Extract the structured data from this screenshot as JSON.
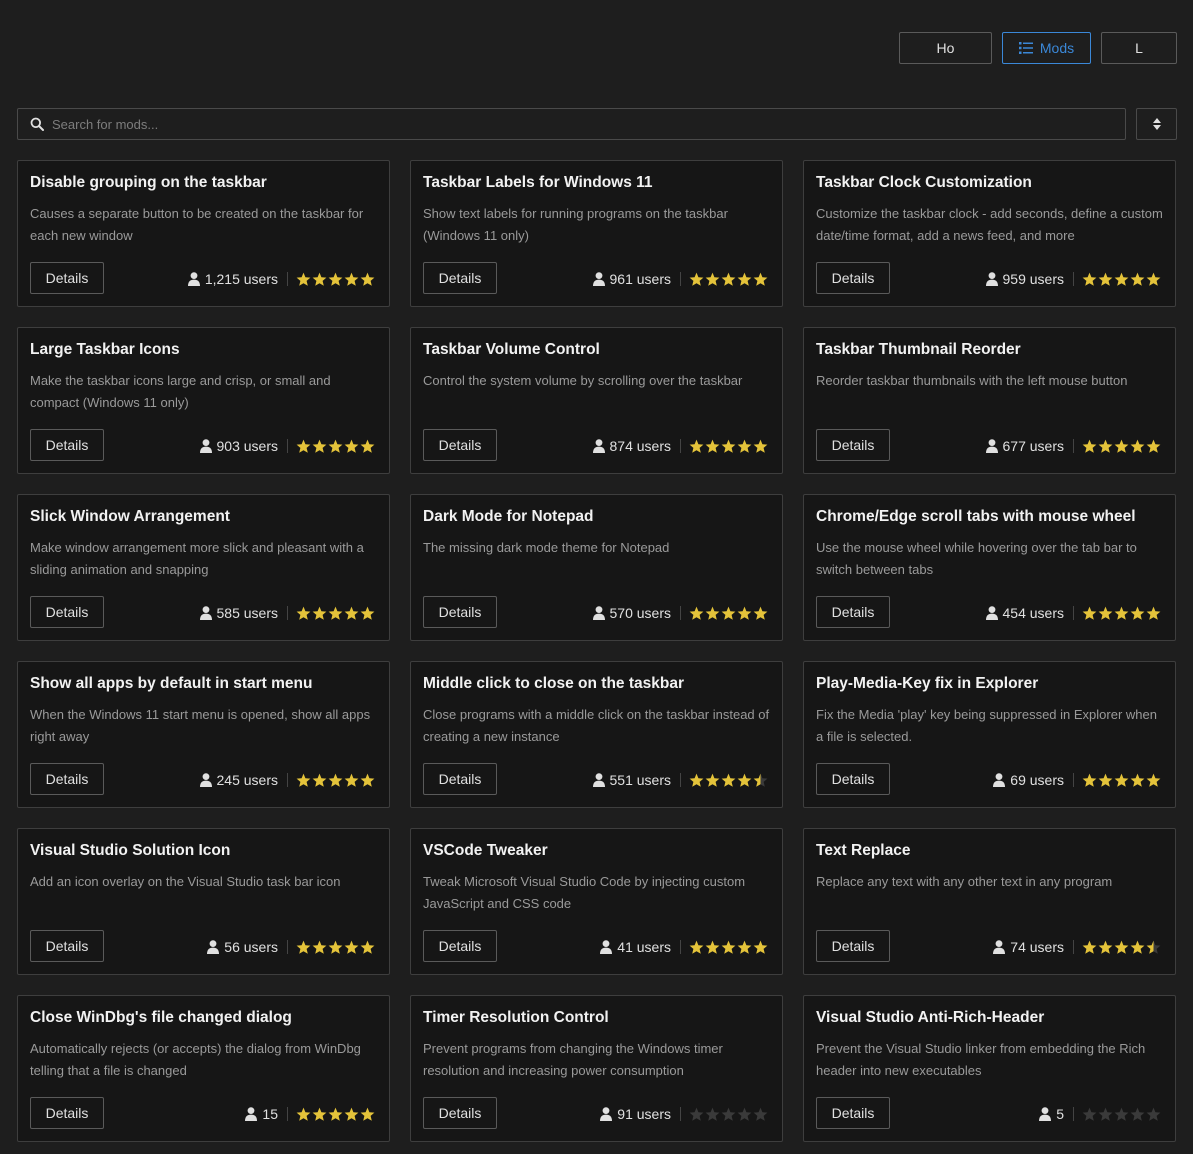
{
  "nav": {
    "home_label": "Ho",
    "mods_label": "Mods",
    "last_label": "L"
  },
  "search": {
    "placeholder": "Search for mods..."
  },
  "details_label": "Details",
  "colors": {
    "accent": "#3b88d8",
    "star": "#e4c33a",
    "star_empty": "#3a3a3a"
  },
  "mods": [
    {
      "title": "Disable grouping on the taskbar",
      "desc": "Causes a separate button to be created on the taskbar for each new window",
      "users": "1,215 users",
      "rating": 5
    },
    {
      "title": "Taskbar Labels for Windows 11",
      "desc": "Show text labels for running programs on the taskbar (Windows 11 only)",
      "users": "961 users",
      "rating": 5
    },
    {
      "title": "Taskbar Clock Customization",
      "desc": "Customize the taskbar clock - add seconds, define a custom date/time format, add a news feed, and more",
      "users": "959 users",
      "rating": 5
    },
    {
      "title": "Large Taskbar Icons",
      "desc": "Make the taskbar icons large and crisp, or small and compact (Windows 11 only)",
      "users": "903 users",
      "rating": 5
    },
    {
      "title": "Taskbar Volume Control",
      "desc": "Control the system volume by scrolling over the taskbar",
      "users": "874 users",
      "rating": 5
    },
    {
      "title": "Taskbar Thumbnail Reorder",
      "desc": "Reorder taskbar thumbnails with the left mouse button",
      "users": "677 users",
      "rating": 5
    },
    {
      "title": "Slick Window Arrangement",
      "desc": "Make window arrangement more slick and pleasant with a sliding animation and snapping",
      "users": "585 users",
      "rating": 5
    },
    {
      "title": "Dark Mode for Notepad",
      "desc": "The missing dark mode theme for Notepad",
      "users": "570 users",
      "rating": 5
    },
    {
      "title": "Chrome/Edge scroll tabs with mouse wheel",
      "desc": "Use the mouse wheel while hovering over the tab bar to switch between tabs",
      "users": "454 users",
      "rating": 5
    },
    {
      "title": "Show all apps by default in start menu",
      "desc": "When the Windows 11 start menu is opened, show all apps right away",
      "users": "245 users",
      "rating": 5
    },
    {
      "title": "Middle click to close on the taskbar",
      "desc": "Close programs with a middle click on the taskbar instead of creating a new instance",
      "users": "551 users",
      "rating": 4.5
    },
    {
      "title": "Play-Media-Key fix in Explorer",
      "desc": "Fix the Media 'play' key being suppressed in Explorer when a file is selected.",
      "users": "69 users",
      "rating": 5
    },
    {
      "title": "Visual Studio Solution Icon",
      "desc": "Add an icon overlay on the Visual Studio task bar icon",
      "users": "56 users",
      "rating": 5
    },
    {
      "title": "VSCode Tweaker",
      "desc": "Tweak Microsoft Visual Studio Code by injecting custom JavaScript and CSS code",
      "users": "41 users",
      "rating": 5
    },
    {
      "title": "Text Replace",
      "desc": "Replace any text with any other text in any program",
      "users": "74 users",
      "rating": 4.5
    },
    {
      "title": "Close WinDbg's file changed dialog",
      "desc": "Automatically rejects (or accepts) the dialog from WinDbg telling that a file is changed",
      "users": "15",
      "rating": 5
    },
    {
      "title": "Timer Resolution Control",
      "desc": "Prevent programs from changing the Windows timer resolution and increasing power consumption",
      "users": "91 users",
      "rating": 0
    },
    {
      "title": "Visual Studio Anti-Rich-Header",
      "desc": "Prevent the Visual Studio linker from embedding the Rich header into new executables",
      "users": "5",
      "rating": 0
    }
  ]
}
